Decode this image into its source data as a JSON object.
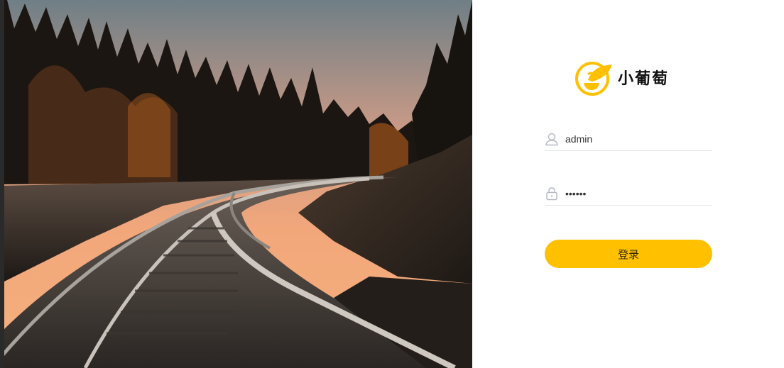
{
  "photo": {
    "alt": "railway"
  },
  "brand": {
    "name": "小葡萄",
    "accent_color": "#ffc000"
  },
  "login": {
    "username_value": "admin",
    "password_value": "••••••",
    "submit_label": "登录",
    "username_icon": "user-icon",
    "password_icon": "lock-icon"
  }
}
